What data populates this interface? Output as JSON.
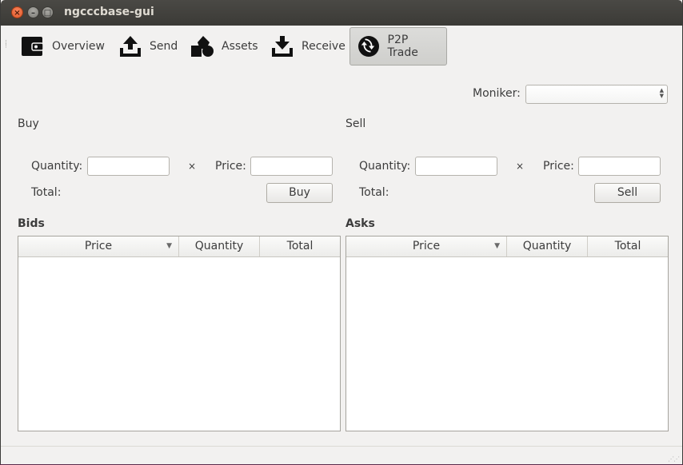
{
  "window": {
    "title": "ngcccbase-gui"
  },
  "toolbar": {
    "items": [
      {
        "label": "Overview",
        "icon": "wallet-icon"
      },
      {
        "label": "Send",
        "icon": "upload-icon"
      },
      {
        "label": "Assets",
        "icon": "shapes-icon"
      },
      {
        "label": "Receive",
        "icon": "download-icon"
      },
      {
        "label": "P2P Trade",
        "icon": "sync-icon",
        "active": true
      }
    ]
  },
  "moniker": {
    "label": "Moniker:",
    "value": ""
  },
  "buy": {
    "heading": "Buy",
    "quantity_label": "Quantity:",
    "times": "×",
    "price_label": "Price:",
    "total_label": "Total:",
    "button": "Buy"
  },
  "sell": {
    "heading": "Sell",
    "quantity_label": "Quantity:",
    "times": "×",
    "price_label": "Price:",
    "total_label": "Total:",
    "button": "Sell"
  },
  "bids": {
    "heading": "Bids",
    "columns": [
      "Price",
      "Quantity",
      "Total"
    ],
    "rows": []
  },
  "asks": {
    "heading": "Asks",
    "columns": [
      "Price",
      "Quantity",
      "Total"
    ],
    "rows": []
  }
}
